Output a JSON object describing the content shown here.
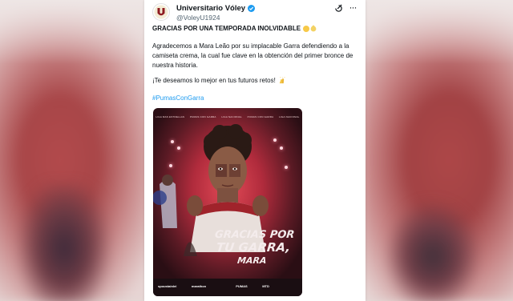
{
  "account": {
    "name": "Universitario Vóley",
    "handle": "@VoleyU1924"
  },
  "tweet": {
    "title": "GRACIAS POR UNA TEMPORADA INOLVIDABLE",
    "body": "Agradecemos a Mara Leão por su implacable Garra defendiendo a la camiseta crema, la cual fue clave en la obtención del primer bronce de nuestra historia.",
    "wish": "¡Te deseamos lo mejor en tus futuros retos!",
    "hashtag": "#PumasConGarra"
  },
  "poster": {
    "caption_line1": "GRACIAS POR",
    "caption_line2": "TU GARRA,",
    "caption_line3": "MARA",
    "top_names": [
      "LIGA MAS ESTRELLAS",
      "PUMAS CON GARRA",
      "LIGA NACIONAL",
      "PUMAS CON GARRA",
      "LIGA NACIONAL"
    ],
    "sponsors": [
      "spoustainlei",
      "marathon",
      "",
      "PUMAS",
      "MTD",
      "",
      ""
    ]
  },
  "icons": {
    "avatar": "universitario-logo",
    "verified": "verified-badge-icon",
    "follow": "follow-grok-icon",
    "more": "more-icon"
  },
  "colors": {
    "link": "#1d9bf0",
    "verified": "#1d9bf0",
    "text": "#0f1419",
    "poster_red": "#b02b3c"
  }
}
